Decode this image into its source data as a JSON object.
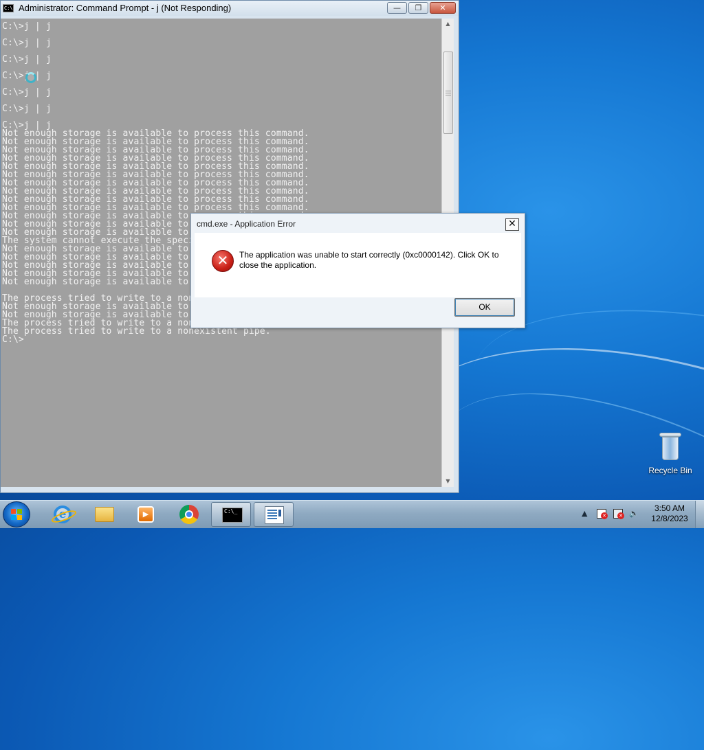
{
  "console_window": {
    "title": "Administrator: Command Prompt - j (Not Responding)",
    "icon_label": "C:\\",
    "minimize_glyph": "—",
    "maximize_glyph": "❐",
    "close_glyph": "✕",
    "output": "C:\\>j | j\n\nC:\\>j | j\n\nC:\\>j | j\n\nC:\\>j | j\n\nC:\\>j | j\n\nC:\\>j | j\n\nC:\\>j | j\nNot enough storage is available to process this command.\nNot enough storage is available to process this command.\nNot enough storage is available to process this command.\nNot enough storage is available to process this command.\nNot enough storage is available to process this command.\nNot enough storage is available to process this command.\nNot enough storage is available to process this command.\nNot enough storage is available to process this command.\nNot enough storage is available to process this command.\nNot enough storage is available to process this command.\nNot enough storage is available to process this command.\nNot enough storage is available to process this command.\nNot enough storage is available to process this command.\nThe system cannot execute the specified program.\nNot enough storage is available to process this command.\nNot enough storage is available to process this command.\nNot enough storage is available to process this command.\nNot enough storage is available to process this command.\nNot enough storage is available to process this command.\n\nThe process tried to write to a nonexistent pipe.\nNot enough storage is available to process this command.\nNot enough storage is available to process this command.\nThe process tried to write to a nonexistent pipe.\nThe process tried to write to a nonexistent pipe.\nC:\\>"
  },
  "error_dialog": {
    "title": "cmd.exe - Application Error",
    "message": "The application was unable to start correctly (0xc0000142). Click OK to close the application.",
    "icon_glyph": "✕",
    "close_glyph": "✕",
    "ok_label": "OK"
  },
  "desktop": {
    "recycle_bin_label": "Recycle Bin"
  },
  "taskbar": {
    "cmd_icon_text": "C:\\_",
    "clock_time": "3:50 AM",
    "clock_date": "12/8/2023",
    "tray_arrow": "▲",
    "volume_glyph": "🔈"
  }
}
